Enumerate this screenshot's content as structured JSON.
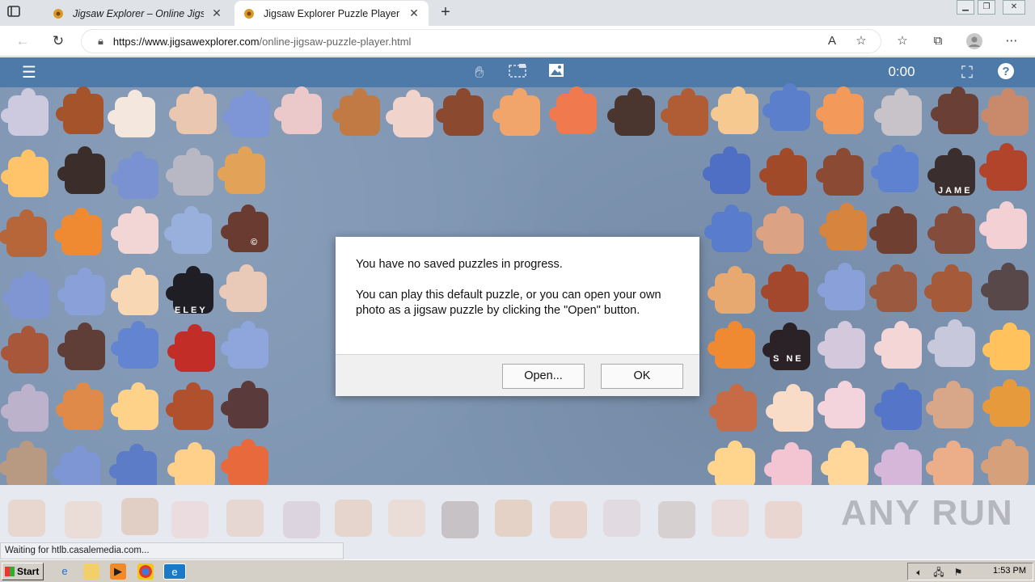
{
  "browser": {
    "tabs": [
      {
        "title": "Jigsaw Explorer – Online Jigsaw",
        "active": false
      },
      {
        "title": "Jigsaw Explorer Puzzle Player",
        "active": true
      }
    ],
    "url_host": "https://www.jigsawexplorer.com",
    "url_path": "/online-jigsaw-puzzle-player.html",
    "new_tab": "+"
  },
  "toolbar": {
    "timer": "0:00",
    "help": "?"
  },
  "pieces_text": {
    "p1": "JAME",
    "p2": "ELEY",
    "p3": "©",
    "p4": "S NE"
  },
  "dialog": {
    "line1": "You have no saved puzzles in progress.",
    "line2": "You can play this default puzzle, or you can open your own photo as a jigsaw puzzle by clicking the \"Open\" button.",
    "open_label": "Open...",
    "ok_label": "OK"
  },
  "status": "Waiting for htlb.casalemedia.com...",
  "watermark": "ANY RUN",
  "taskbar": {
    "start": "Start",
    "clock": "1:53 PM"
  },
  "colors": {
    "toolbar": "#4d7aa8",
    "board": "#7e95b2",
    "accent": "#3a6fb0"
  }
}
